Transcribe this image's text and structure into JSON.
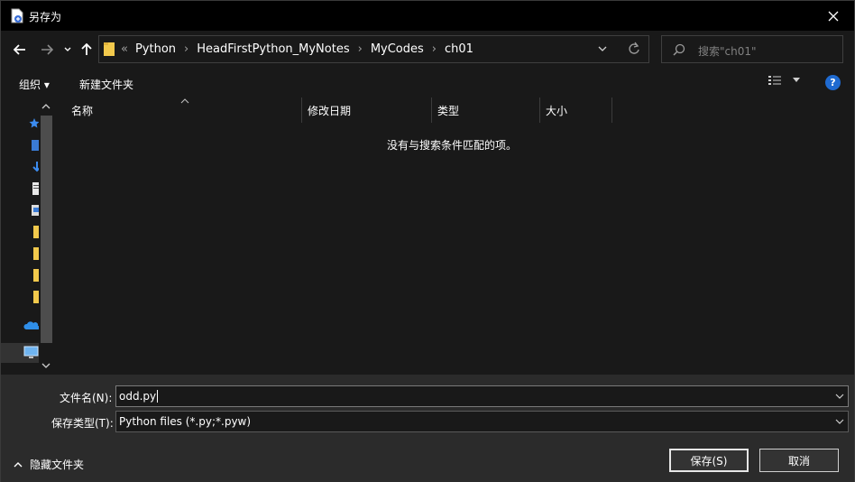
{
  "window": {
    "title": "另存为"
  },
  "icons": {
    "app": "save-document-icon",
    "close": "close-icon",
    "back": "arrow-left-icon",
    "forward": "arrow-right-icon",
    "recent": "chevron-down-icon",
    "up": "arrow-up-icon",
    "folder": "folder-icon",
    "refresh": "refresh-icon",
    "search": "search-icon",
    "help": "help-icon",
    "view": "details-view-icon"
  },
  "address": {
    "overflow": "«",
    "crumbs": [
      "Python",
      "HeadFirstPython_MyNotes",
      "MyCodes",
      "ch01"
    ]
  },
  "search": {
    "placeholder": "搜索\"ch01\""
  },
  "commands": {
    "organize": "组织 ▾",
    "new_folder": "新建文件夹",
    "help": "?"
  },
  "columns": [
    "名称",
    "修改日期",
    "类型",
    "大小"
  ],
  "empty_message": "没有与搜索条件匹配的项。",
  "form": {
    "filename_label": "文件名(N):",
    "filename_value": "odd.py",
    "filetype_label": "保存类型(T):",
    "filetype_value": "Python files (*.py;*.pyw)"
  },
  "footer": {
    "hide_folders": "隐藏文件夹",
    "save": "保存(S)",
    "cancel": "取消"
  },
  "colors": {
    "background": "#191919",
    "bottom_panel": "#2b2b2b",
    "accent_blue": "#1f6ad0",
    "folder_yellow": "#f2c94c"
  }
}
